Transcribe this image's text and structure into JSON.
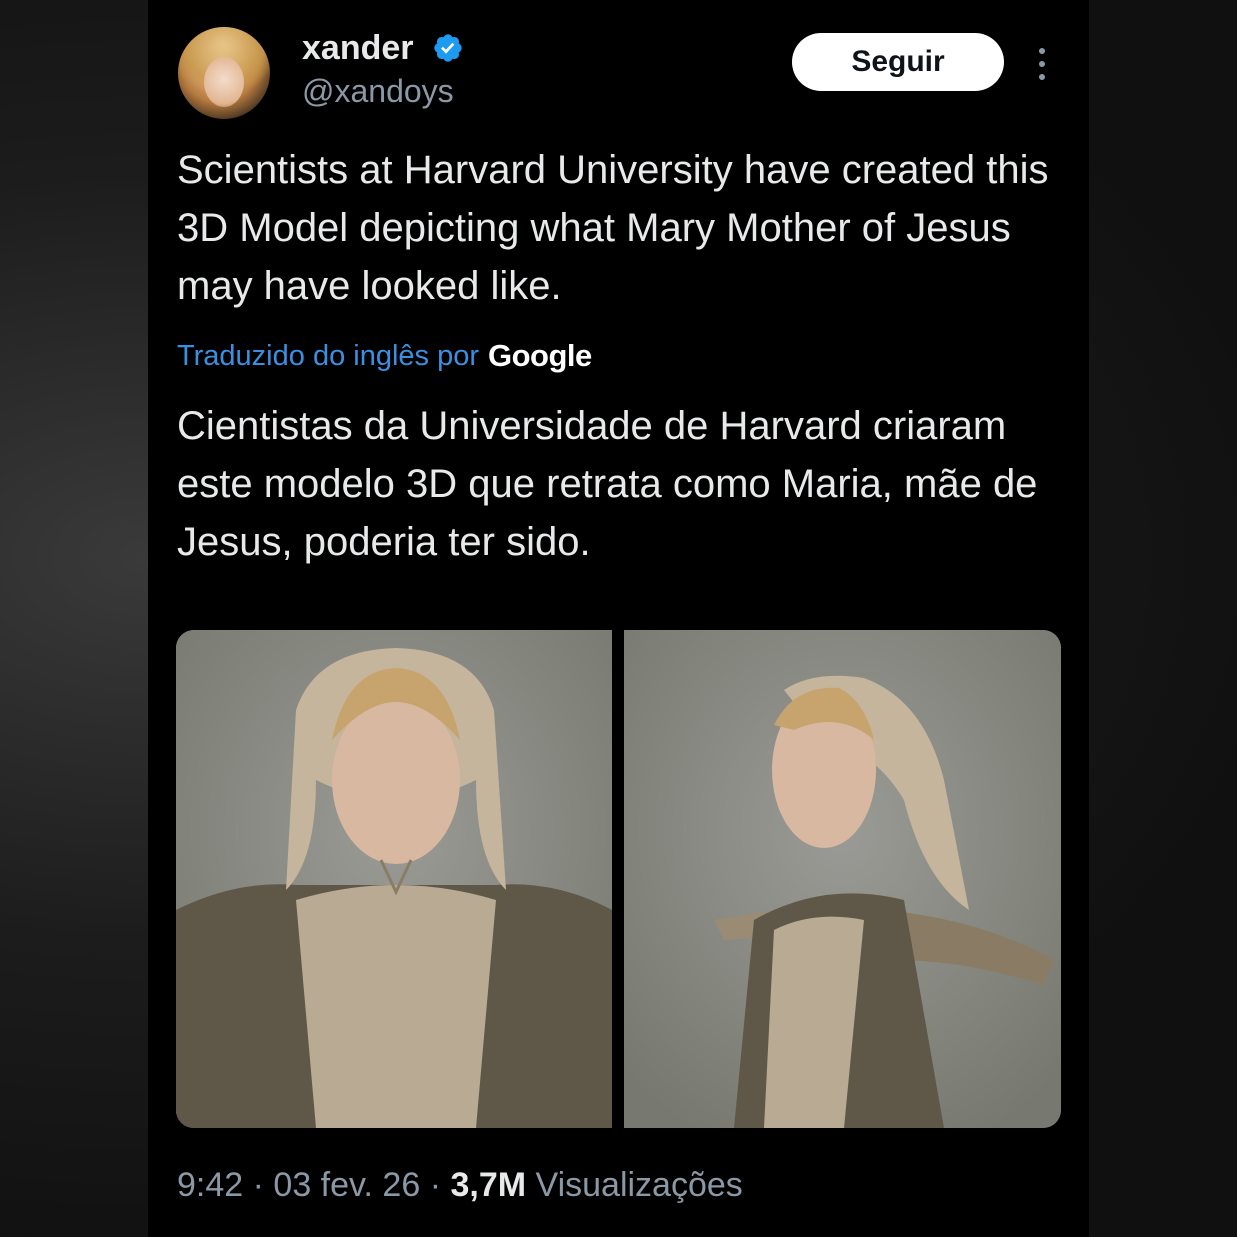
{
  "user": {
    "display_name": "xander",
    "handle": "@xandoys",
    "verified": true,
    "verified_color": "#1d9bf0"
  },
  "follow_button": {
    "label": "Seguir"
  },
  "tweet": {
    "text": "Scientists at Harvard University have created this 3D Model depicting what Mary Mother of Jesus may have looked like.",
    "translation_label": "Traduzido do inglês por",
    "translation_provider": "Google",
    "translated_text": "Cientistas da Universidade de Harvard criaram este modelo 3D que retrata como Maria, mãe de Jesus, poderia ter sido."
  },
  "meta": {
    "time": "9:42",
    "separator": "·",
    "date": "03 fev. 26",
    "views_count": "3,7M",
    "views_label": "Visualizações"
  },
  "colors": {
    "background": "#000000",
    "text_primary": "#e7e9ea",
    "text_secondary": "#8b98a5",
    "link": "#3b8fe0"
  },
  "icons": {
    "more": "more-vertical-icon",
    "verified": "verified-badge-icon"
  }
}
